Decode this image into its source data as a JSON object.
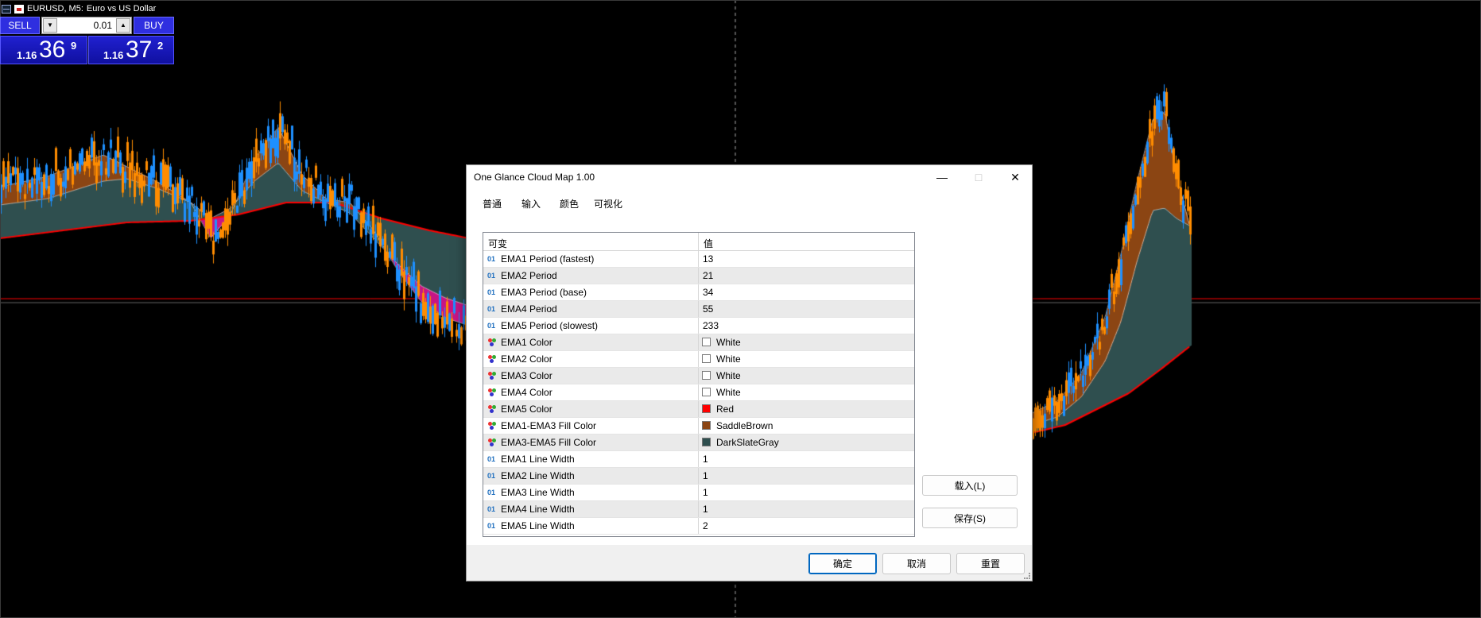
{
  "chart": {
    "symbol": "EURUSD, M5:",
    "description": "Euro vs US Dollar",
    "colors": {
      "background": "#000000",
      "bull_candle": "#1e90ff",
      "bear_candle": "#ff8c00",
      "fill_fast": "#8b4513",
      "fill_slow": "#2f4f4f",
      "cross_fill": "#c71585",
      "ema_line": "#ffffff",
      "ema_slow": "#ff0000",
      "bid_line": "#ff0000",
      "crosshair": "#aaaaaa"
    }
  },
  "trade_panel": {
    "sell_label": "SELL",
    "buy_label": "BUY",
    "lot": "0.01",
    "sell_price_prefix": "1.16",
    "sell_price_big": "36",
    "sell_price_sup": "9",
    "buy_price_prefix": "1.16",
    "buy_price_big": "37",
    "buy_price_sup": "2"
  },
  "dialog": {
    "title": "One Glance Cloud Map 1.00",
    "tabs": [
      {
        "label": "普通"
      },
      {
        "label": "输入"
      },
      {
        "label": "颜色"
      },
      {
        "label": "可视化"
      }
    ],
    "active_tab": "输入",
    "grid": {
      "col_variable": "可变",
      "col_value": "值",
      "rows": [
        {
          "icon": "01",
          "label": "EMA1 Period (fastest)",
          "value": "13"
        },
        {
          "icon": "01",
          "label": "EMA2 Period",
          "value": "21"
        },
        {
          "icon": "01",
          "label": "EMA3 Period (base)",
          "value": "34"
        },
        {
          "icon": "01",
          "label": "EMA4 Period",
          "value": "55"
        },
        {
          "icon": "01",
          "label": "EMA5 Period (slowest)",
          "value": "233"
        },
        {
          "icon": "color",
          "label": "EMA1 Color",
          "value": "White",
          "swatch": "#ffffff"
        },
        {
          "icon": "color",
          "label": "EMA2 Color",
          "value": "White",
          "swatch": "#ffffff"
        },
        {
          "icon": "color",
          "label": "EMA3 Color",
          "value": "White",
          "swatch": "#ffffff"
        },
        {
          "icon": "color",
          "label": "EMA4 Color",
          "value": "White",
          "swatch": "#ffffff"
        },
        {
          "icon": "color",
          "label": "EMA5 Color",
          "value": "Red",
          "swatch": "#ff0000"
        },
        {
          "icon": "color",
          "label": "EMA1-EMA3 Fill Color",
          "value": "SaddleBrown",
          "swatch": "#8b4513"
        },
        {
          "icon": "color",
          "label": "EMA3-EMA5 Fill Color",
          "value": "DarkSlateGray",
          "swatch": "#2f4f4f"
        },
        {
          "icon": "01",
          "label": "EMA1 Line Width",
          "value": "1"
        },
        {
          "icon": "01",
          "label": "EMA2 Line Width",
          "value": "1"
        },
        {
          "icon": "01",
          "label": "EMA3 Line Width",
          "value": "1"
        },
        {
          "icon": "01",
          "label": "EMA4 Line Width",
          "value": "1"
        },
        {
          "icon": "01",
          "label": "EMA5 Line Width",
          "value": "2"
        }
      ]
    },
    "load_button": "载入(L)",
    "save_button": "保存(S)",
    "ok_button": "确定",
    "cancel_button": "取消",
    "reset_button": "重置"
  }
}
